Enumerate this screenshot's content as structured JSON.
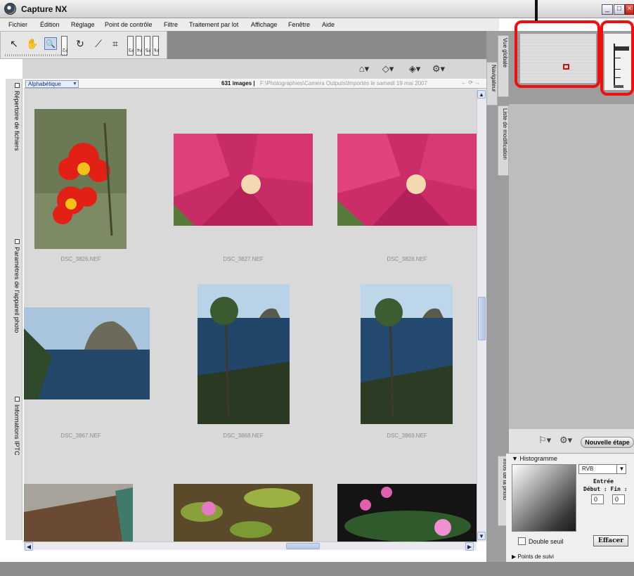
{
  "window": {
    "title": "Capture NX",
    "min_label": "_",
    "max_label": "□",
    "close_label": "×"
  },
  "menu": [
    "Fichier",
    "Édition",
    "Réglage",
    "Point de contrôle",
    "Filtre",
    "Traitement par lot",
    "Affichage",
    "Fenêtre",
    "Aide"
  ],
  "toolbar": {
    "tools": [
      {
        "icon": "arrow-select-icon",
        "glyph": "↖"
      },
      {
        "icon": "hand-icon",
        "glyph": "✋"
      },
      {
        "icon": "zoom-icon",
        "glyph": "🔍"
      },
      {
        "icon": "rotate-icon",
        "glyph": "↻"
      },
      {
        "icon": "straighten-icon",
        "glyph": "⟋"
      },
      {
        "icon": "crop-icon",
        "glyph": "⌗"
      }
    ],
    "fkeys": [
      "F2",
      "F3",
      "F4",
      "F5",
      "F6"
    ]
  },
  "left_tabs": [
    "Répertoire de fichiers",
    "Paramètres de l'appareil photo",
    "Informations IPTC"
  ],
  "browser": {
    "sort_label": "Alphabétique",
    "image_count": "631 images |",
    "path": "F:\\Photographies\\Camera Outputs\\Importés le samedi 19 mai 2007",
    "thumbnails": [
      {
        "caption": "DSC_3826.NEF",
        "subject": "red-flower"
      },
      {
        "caption": "DSC_3827.NEF",
        "subject": "pink-flower"
      },
      {
        "caption": "DSC_3828.NEF",
        "subject": "pink-flower"
      },
      {
        "caption": "DSC_3867.NEF",
        "subject": "rock-sea"
      },
      {
        "caption": "DSC_3868.NEF",
        "subject": "tree-sea"
      },
      {
        "caption": "DSC_3869.NEF",
        "subject": "tree-sea"
      },
      {
        "caption": "",
        "subject": "boat"
      },
      {
        "caption": "",
        "subject": "lily-pond"
      },
      {
        "caption": "",
        "subject": "lily-dark"
      }
    ]
  },
  "right_tabs": [
    "Vue globale",
    "Navigateur",
    "Liste de modification",
    "Infos de la photo"
  ],
  "edit_list": {
    "new_step_label": "Nouvelle étape"
  },
  "histogram": {
    "title": "Histogramme",
    "channel": "RVB",
    "entry_label": "Entrée",
    "range_label": "Début : Fin :",
    "start_value": "0",
    "end_value": "0",
    "double_threshold_label": "Double seuil",
    "clear_label": "Effacer",
    "tracking_points_label": "Points de suivi"
  },
  "colors": {
    "highlight": "#ee1010",
    "accent": "#5a7fb8"
  }
}
